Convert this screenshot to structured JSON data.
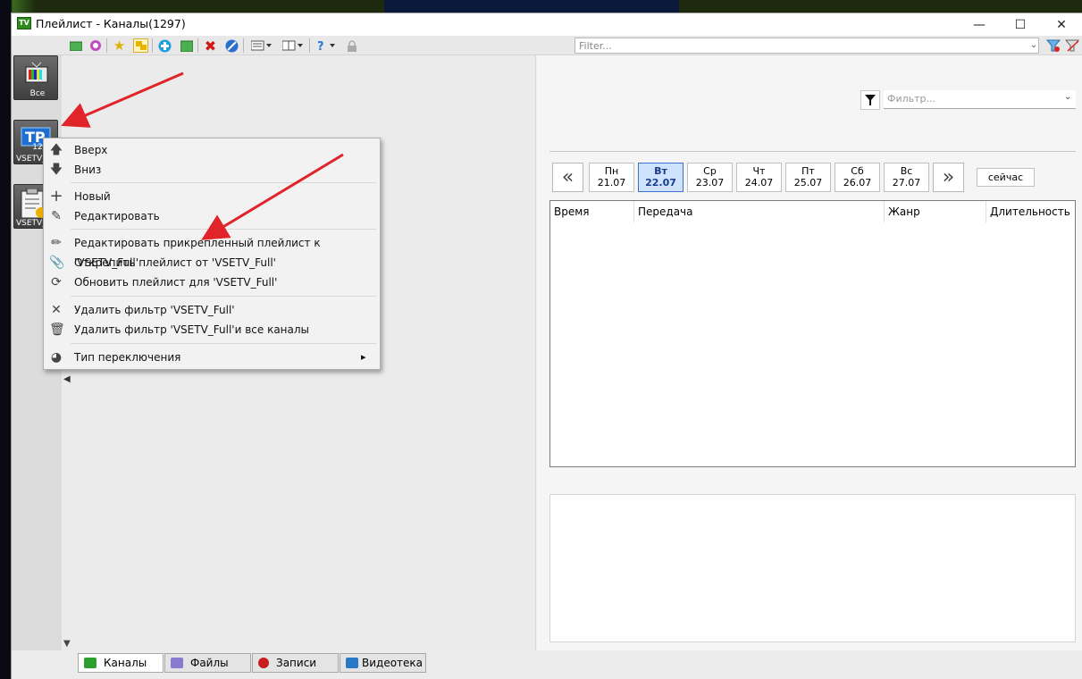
{
  "window": {
    "title": "Плейлист - Каналы(1297)",
    "app_icon_text": "TV",
    "controls": {
      "minimize": "—",
      "maximize": "☐",
      "close": "✕"
    }
  },
  "toolbar": {
    "filter_placeholder": "Filter...",
    "icons": [
      "folder-green-icon",
      "refresh-icon",
      "star-icon",
      "folders-icon",
      "add-circle-icon",
      "export-icon",
      "delete-icon",
      "block-icon",
      "list-view-icon",
      "panel-view-icon",
      "help-icon",
      "lock-icon",
      "filter-clear-icon",
      "filter-settings-icon"
    ]
  },
  "sidebar": {
    "items": [
      {
        "label": "Все",
        "icon": "tv-icon"
      },
      {
        "label": "VSETV_F",
        "count": "12",
        "icon": "playlist-icon"
      },
      {
        "label": "VSETV_",
        "icon": "clipboard-icon"
      }
    ]
  },
  "context_menu": {
    "items": [
      {
        "label": "Вверх",
        "icon": "arrow-up-icon"
      },
      {
        "label": "Вниз",
        "icon": "arrow-down-icon"
      },
      {
        "label": "Новый",
        "icon": "plus-icon"
      },
      {
        "label": "Редактировать",
        "icon": "edit-icon"
      },
      {
        "label": "Редактировать прикрепленный плейлист к 'VSETV_Full'",
        "icon": "pencil-icon"
      },
      {
        "label": "Открепить плейлист от 'VSETV_Full'",
        "icon": "paperclip-icon"
      },
      {
        "label": "Обновить плейлист для 'VSETV_Full'",
        "icon": "refresh-icon"
      },
      {
        "label": "Удалить фильтр 'VSETV_Full'",
        "icon": "close-icon"
      },
      {
        "label": "Удалить фильтр 'VSETV_Full'и все каналы",
        "icon": "trash-icon"
      },
      {
        "label": "Тип переключения",
        "icon": "pie-icon",
        "submenu_arrow": "▸"
      }
    ]
  },
  "epg": {
    "filter_placeholder": "Фильтр...",
    "days": [
      {
        "name": "Пн",
        "date": "21.07"
      },
      {
        "name": "Вт",
        "date": "22.07",
        "selected": true
      },
      {
        "name": "Ср",
        "date": "23.07"
      },
      {
        "name": "Чт",
        "date": "24.07"
      },
      {
        "name": "Пт",
        "date": "25.07"
      },
      {
        "name": "Сб",
        "date": "26.07"
      },
      {
        "name": "Вс",
        "date": "27.07"
      }
    ],
    "prev": "«",
    "next": "»",
    "now_label": "сейчас",
    "columns": [
      "Время",
      "Передача",
      "Жанр",
      "Длительность"
    ]
  },
  "bottom_tabs": [
    {
      "label": "Каналы",
      "color": "#2e9e2e"
    },
    {
      "label": "Файлы",
      "color": "#8a7bd0"
    },
    {
      "label": "Записи",
      "color": "#c81e1e"
    },
    {
      "label": "Видеотека",
      "color": "#2a78c8"
    }
  ],
  "colors": {
    "arrow": "#e0242a",
    "selected_day": "#cfe3ff"
  }
}
